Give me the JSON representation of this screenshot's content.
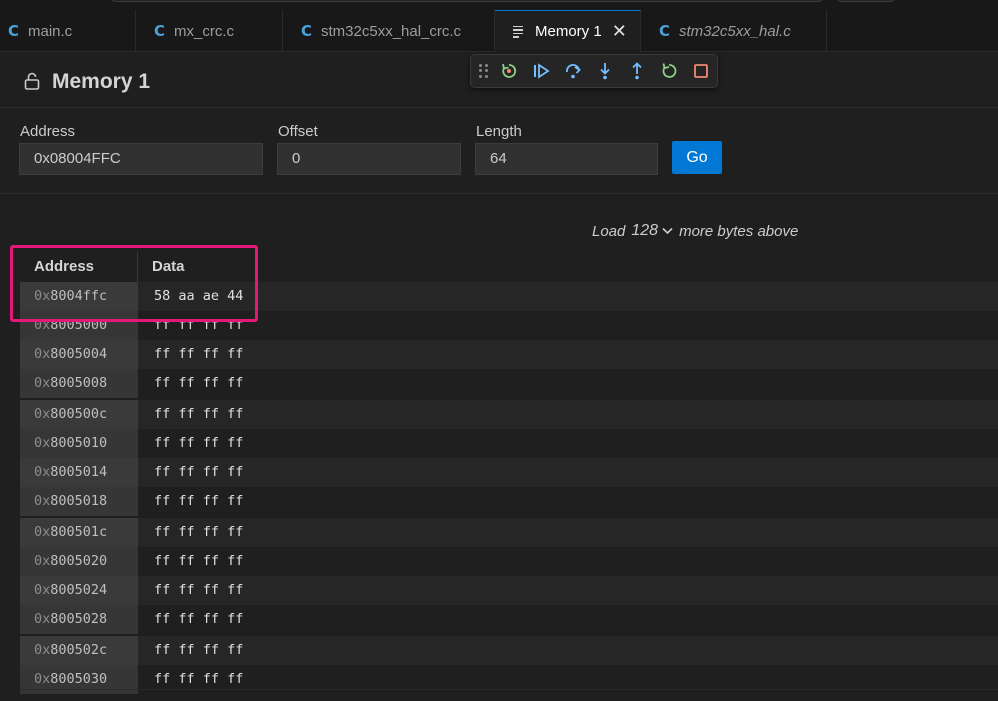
{
  "tabs": [
    {
      "label": "main.c",
      "icon": "c-file-icon"
    },
    {
      "label": "mx_crc.c",
      "icon": "c-file-icon"
    },
    {
      "label": "stm32c5xx_hal_crc.c",
      "icon": "c-file-icon"
    },
    {
      "label": "Memory 1",
      "icon": "memory-view-icon",
      "active": true
    },
    {
      "label": "stm32c5xx_hal.c",
      "icon": "c-file-icon",
      "italic": true
    }
  ],
  "tab_c_glyph": "C",
  "tab_close_glyph": "✕",
  "header": {
    "title": "Memory 1"
  },
  "form": {
    "address_label": "Address",
    "address_value": "0x08004FFC",
    "offset_label": "Offset",
    "offset_value": "0",
    "length_label": "Length",
    "length_value": "64",
    "go_label": "Go"
  },
  "load_above": {
    "prefix": "Load",
    "count": "128",
    "suffix": "more bytes above"
  },
  "table": {
    "columns": [
      "Address",
      "Data"
    ],
    "rows": [
      {
        "address": "0x8004ffc",
        "data": "58 aa ae 44"
      },
      {
        "address": "0x8005000",
        "data": "ff ff ff ff"
      },
      {
        "address": "0x8005004",
        "data": "ff ff ff ff"
      },
      {
        "address": "0x8005008",
        "data": "ff ff ff ff"
      },
      {
        "address": "0x800500c",
        "data": "ff ff ff ff"
      },
      {
        "address": "0x8005010",
        "data": "ff ff ff ff"
      },
      {
        "address": "0x8005014",
        "data": "ff ff ff ff"
      },
      {
        "address": "0x8005018",
        "data": "ff ff ff ff"
      },
      {
        "address": "0x800501c",
        "data": "ff ff ff ff"
      },
      {
        "address": "0x8005020",
        "data": "ff ff ff ff"
      },
      {
        "address": "0x8005024",
        "data": "ff ff ff ff"
      },
      {
        "address": "0x8005028",
        "data": "ff ff ff ff"
      },
      {
        "address": "0x800502c",
        "data": "ff ff ff ff"
      },
      {
        "address": "0x8005030",
        "data": "ff ff ff ff"
      }
    ]
  },
  "debug_toolbar": [
    "drag-handle-icon",
    "restart-frame-icon",
    "continue-icon",
    "step-over-icon",
    "step-into-icon",
    "step-out-icon",
    "restart-icon",
    "stop-icon"
  ],
  "colors": {
    "accent": "#0078d4",
    "highlight": "#e5177a",
    "c_icon": "#4aa3d8",
    "debug_green": "#89d185",
    "debug_blue": "#75beff",
    "debug_red": "#f48771"
  }
}
